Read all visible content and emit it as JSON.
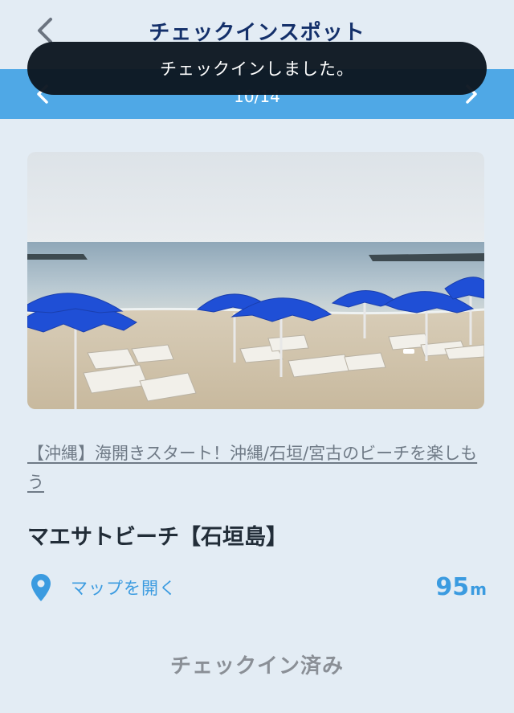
{
  "header": {
    "title": "チェックインスポット",
    "back_icon": "chevron-left-icon"
  },
  "pager": {
    "current": "10/14",
    "prev_icon": "chevron-left-icon",
    "next_icon": "chevron-right-icon"
  },
  "toast": {
    "message": "チェックインしました。"
  },
  "photo": {
    "subject": "beach-with-blue-parasols-photo"
  },
  "article": {
    "link_text": "【沖縄】海開きスタート！沖縄/石垣/宮古のビーチを楽しもう"
  },
  "spot": {
    "name": "マエサトビーチ【石垣島】",
    "map_label": "マップを開く",
    "map_icon": "map-pin-icon",
    "distance_value": "95",
    "distance_unit": "m"
  },
  "status": {
    "checked_in": "チェックイン済み"
  },
  "colors": {
    "background": "#e3ecf4",
    "title": "#14306a",
    "pager_bar": "#4fa8e6",
    "accent": "#3b9be0",
    "toast": "#0c1620",
    "muted": "#8a8f96"
  }
}
